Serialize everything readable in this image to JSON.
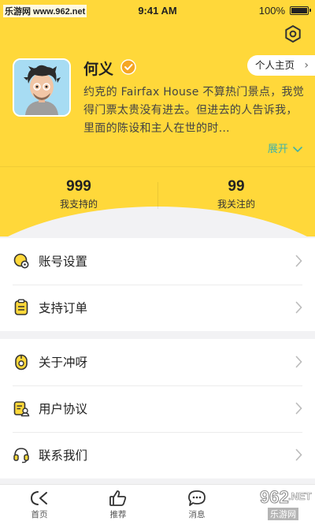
{
  "watermark": {
    "top": "乐游网 www.962.net",
    "brand": "962",
    "brand_suffix": ".NET",
    "brand_sub": "乐游网"
  },
  "status_bar": {
    "time": "9:41 AM",
    "battery": "100%"
  },
  "profile": {
    "name": "何义",
    "profile_button": "个人主页",
    "bio": "约克的 Fairfax House 不算热门景点，我觉得门票太贵没有进去。但进去的人告诉我，里面的陈设和主人在世的时…",
    "expand_label": "展开"
  },
  "stats": [
    {
      "value": "999",
      "label": "我支持的"
    },
    {
      "value": "99",
      "label": "我关注的"
    }
  ],
  "menu_groups": [
    {
      "items": [
        {
          "label": "账号设置",
          "icon": "account-settings-icon"
        },
        {
          "label": "支持订单",
          "icon": "orders-icon"
        }
      ]
    },
    {
      "items": [
        {
          "label": "关于冲呀",
          "icon": "about-icon"
        },
        {
          "label": "用户协议",
          "icon": "agreement-icon"
        },
        {
          "label": "联系我们",
          "icon": "contact-icon"
        }
      ]
    }
  ],
  "tabs": [
    {
      "label": "首页",
      "icon": "home-icon"
    },
    {
      "label": "推荐",
      "icon": "thumbs-up-icon"
    },
    {
      "label": "消息",
      "icon": "message-icon"
    }
  ],
  "colors": {
    "header": "#ffd83a",
    "accent_teal": "#3fb2a8",
    "background": "#f2f2f4"
  }
}
